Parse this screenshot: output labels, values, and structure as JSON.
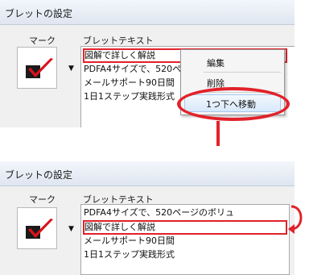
{
  "before": {
    "title": "ブレットの設定",
    "mark_header": "マーク",
    "text_header": "ブレットテキスト",
    "items": [
      "図解で詳しく解説",
      "PDFA4サイズで、520ページのボリュ",
      "メールサポート90日間",
      "1日1ステップ実践形式"
    ],
    "selected_index": 0,
    "context_menu": [
      "編集",
      "削除",
      "1つ下へ移動"
    ],
    "highlighted_menu_item": "1つ下へ移動"
  },
  "after": {
    "title": "ブレットの設定",
    "mark_header": "マーク",
    "text_header": "ブレットテキスト",
    "items": [
      "PDFA4サイズで、520ページのボリュ",
      "図解で詳しく解説",
      "メールサポート90日間",
      "1日1ステップ実践形式"
    ],
    "selected_index": 1
  },
  "colors": {
    "annotation": "#e2222a",
    "check_mark": "#d8131c",
    "check_box": "#1a1a1a"
  },
  "icons": [
    "checkmark-bullet-icon",
    "dropdown-arrow-icon",
    "down-arrow-annotation-icon",
    "curved-arrow-annotation-icon"
  ]
}
